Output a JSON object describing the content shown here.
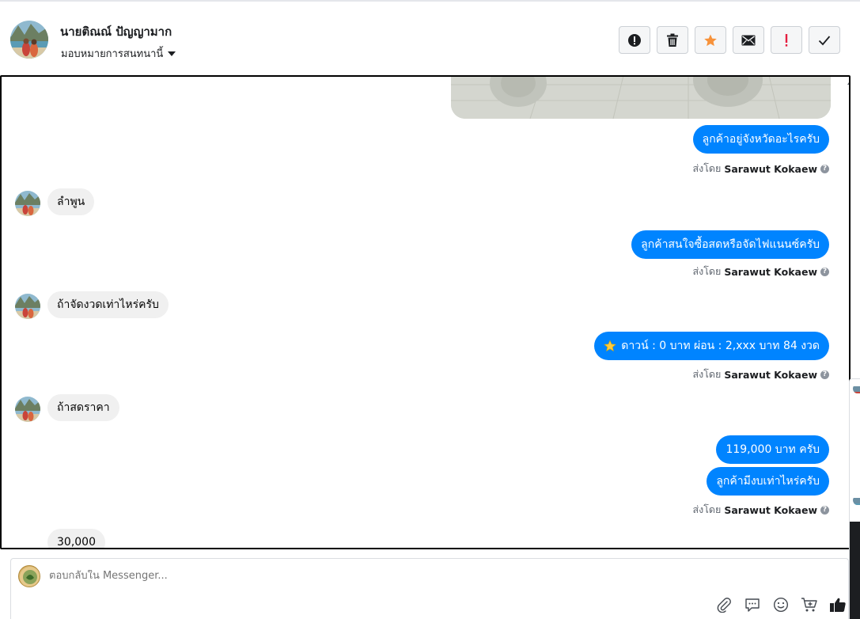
{
  "header": {
    "customer_name": "นายติณณ์ ปัญญามาก",
    "assign_label": "มอบหมายการสนทนานี้",
    "toolbar": [
      {
        "name": "report-spam-button",
        "icon": "exclamation-circle-icon"
      },
      {
        "name": "delete-button",
        "icon": "trash-icon"
      },
      {
        "name": "star-button",
        "icon": "star-icon"
      },
      {
        "name": "mark-unread-button",
        "icon": "envelope-icon"
      },
      {
        "name": "follow-up-button",
        "icon": "exclamation-icon"
      },
      {
        "name": "mark-done-button",
        "icon": "check-icon"
      }
    ]
  },
  "messages": {
    "m1": "ลูกค้าอยู่จังหวัดอะไรครับ",
    "m2": "ลำพูน",
    "m3": "ลูกค้าสนใจซื้อสดหรือจัดไฟแนนซ์ครับ",
    "m4": "ถ้าจัดงวดเท่าไหร่ครับ",
    "m5": "ดาวน์ : 0 บาท ผ่อน : 2,xxx บาท 84 งวด",
    "m6": "ถ้าสดราคา",
    "m7": "119,000 บาท ครับ",
    "m8": "ลูกค้ามีงบเท่าไหร่ครับ",
    "m9": "30,000"
  },
  "sent_by": {
    "prefix": "ส่งโดย",
    "agent": "Sarawut Kokaew",
    "help": "?"
  },
  "composer": {
    "placeholder": "ตอบกลับใน Messenger...",
    "icons": [
      "paperclip-icon",
      "saved-reply-icon",
      "emoji-icon",
      "cart-icon",
      "like-icon"
    ]
  },
  "colors": {
    "outgoing_bubble": "#0084ff",
    "incoming_bubble": "#f0f0f0",
    "star": "#f7923a",
    "follow_up": "#e41e3f"
  }
}
